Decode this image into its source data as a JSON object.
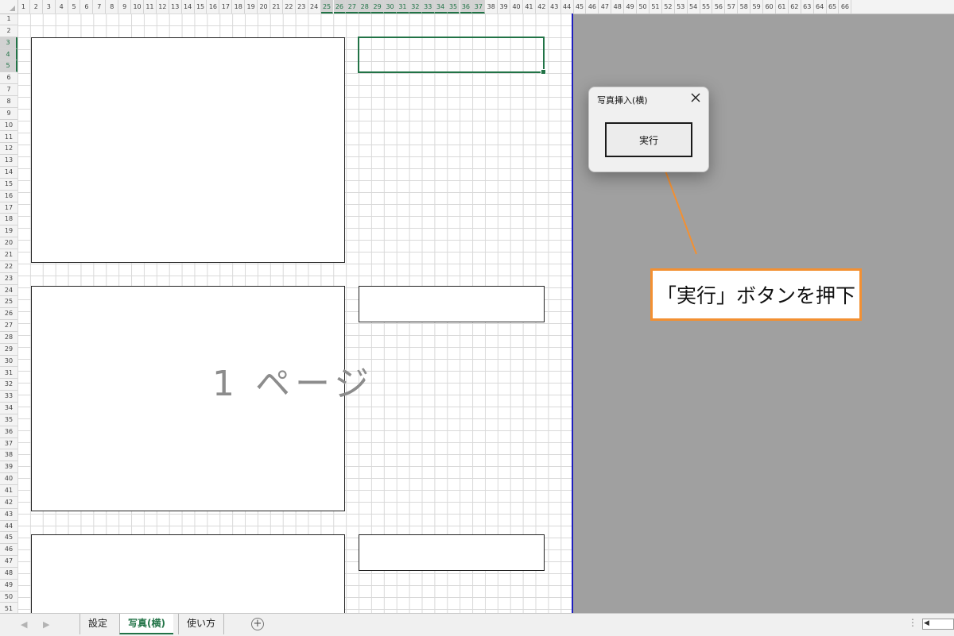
{
  "spreadsheet": {
    "column_headers": [
      "1",
      "2",
      "3",
      "4",
      "5",
      "6",
      "7",
      "8",
      "9",
      "10",
      "11",
      "12",
      "13",
      "14",
      "15",
      "16",
      "17",
      "18",
      "19",
      "20",
      "21",
      "22",
      "23",
      "24",
      "25",
      "26",
      "27",
      "28",
      "29",
      "30",
      "31",
      "32",
      "33",
      "34",
      "35",
      "36",
      "37",
      "38",
      "39",
      "40",
      "41",
      "42",
      "43",
      "44",
      "45",
      "46",
      "47",
      "48",
      "49",
      "50",
      "51",
      "52",
      "53",
      "54",
      "55",
      "56",
      "57",
      "58",
      "59",
      "60",
      "61",
      "62",
      "63",
      "64",
      "65",
      "66"
    ],
    "selected_columns": [
      "25",
      "26",
      "27",
      "28",
      "29",
      "30",
      "31",
      "32",
      "33",
      "34",
      "35",
      "36",
      "37"
    ],
    "row_headers": [
      "1",
      "2",
      "3",
      "4",
      "5",
      "6",
      "7",
      "8",
      "9",
      "10",
      "11",
      "12",
      "13",
      "14",
      "15",
      "16",
      "17",
      "18",
      "19",
      "20",
      "21",
      "22",
      "23",
      "24",
      "25",
      "26",
      "27",
      "28",
      "29",
      "30",
      "31",
      "32",
      "33",
      "34",
      "35",
      "36",
      "37",
      "38",
      "39",
      "40",
      "41",
      "42",
      "43",
      "44",
      "45",
      "46",
      "47",
      "48",
      "49",
      "50",
      "51"
    ],
    "selected_rows": [
      "3",
      "4",
      "5"
    ],
    "page_watermark": "1 ページ"
  },
  "dialog": {
    "title": "写真挿入(横)",
    "execute_button": "実行",
    "close_icon": "close-icon"
  },
  "callout": {
    "text": "「実行」ボタンを押下",
    "border_color": "#f39032"
  },
  "sheet_tabs": {
    "tabs": [
      {
        "label": "設定",
        "active": false
      },
      {
        "label": "写真(横)",
        "active": true
      },
      {
        "label": "使い方",
        "active": false
      }
    ],
    "add_sheet_icon": "plus-circle-icon"
  },
  "colors": {
    "accent": "#217346",
    "page_border": "#1f1fbf",
    "workspace_gray": "#a0a0a0"
  }
}
